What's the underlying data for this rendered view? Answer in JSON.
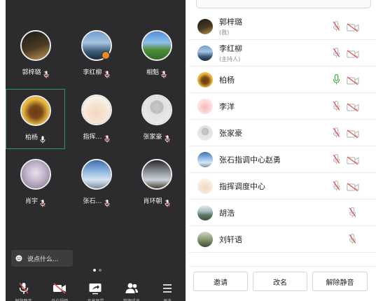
{
  "grid": {
    "tiles": [
      {
        "name": "郭梓璐",
        "mic": "muted"
      },
      {
        "name": "李红柳",
        "mic": "muted",
        "host": true
      },
      {
        "name": "相魁",
        "mic": "muted"
      },
      {
        "name": "柏杨",
        "mic": "on",
        "active": true
      },
      {
        "name": "指挥…",
        "mic": "muted"
      },
      {
        "name": "张家豪",
        "mic": "muted"
      },
      {
        "name": "肖宇",
        "mic": "muted"
      },
      {
        "name": "张石…",
        "mic": "muted"
      },
      {
        "name": "肖环朝",
        "mic": "muted"
      }
    ],
    "chat_placeholder": "说点什么...",
    "page_dots": 2,
    "page_index": 0
  },
  "toolbar": {
    "buttons": [
      {
        "icon": "mic-muted-icon",
        "label": "解除静音"
      },
      {
        "icon": "camera-off-icon",
        "label": "开启视频"
      },
      {
        "icon": "share-screen-icon",
        "label": "共享屏幕"
      },
      {
        "icon": "members-icon",
        "label": "管理成员"
      },
      {
        "icon": "more-icon",
        "label": "更多"
      }
    ]
  },
  "members": [
    {
      "name": "郭梓璐",
      "role": "(我)",
      "mic": "muted",
      "cam": "off"
    },
    {
      "name": "李红柳",
      "role": "(主持人)",
      "mic": "muted",
      "cam": "off"
    },
    {
      "name": "柏杨",
      "role": "",
      "mic": "on",
      "cam": "off"
    },
    {
      "name": "李洋",
      "role": "",
      "mic": "muted",
      "cam": "off"
    },
    {
      "name": "张家豪",
      "role": "",
      "mic": "muted",
      "cam": "off"
    },
    {
      "name": "张石指调中心赵勇",
      "role": "",
      "mic": "muted",
      "cam": "off"
    },
    {
      "name": "指挥调度中心",
      "role": "",
      "mic": "muted",
      "cam": "off"
    },
    {
      "name": "胡浩",
      "role": "",
      "mic": "muted",
      "cam": "none"
    },
    {
      "name": "刘轩语",
      "role": "",
      "mic": "muted",
      "cam": "none"
    }
  ],
  "actions": {
    "invite": "邀请",
    "rename": "改名",
    "unmute": "解除静音"
  },
  "colors": {
    "grid_bg": "#2c2c2e",
    "active_border": "#2f9a60",
    "muted_red": "#d9534f",
    "mic_on_green": "#4caf50",
    "host_badge": "#e88b2c"
  }
}
